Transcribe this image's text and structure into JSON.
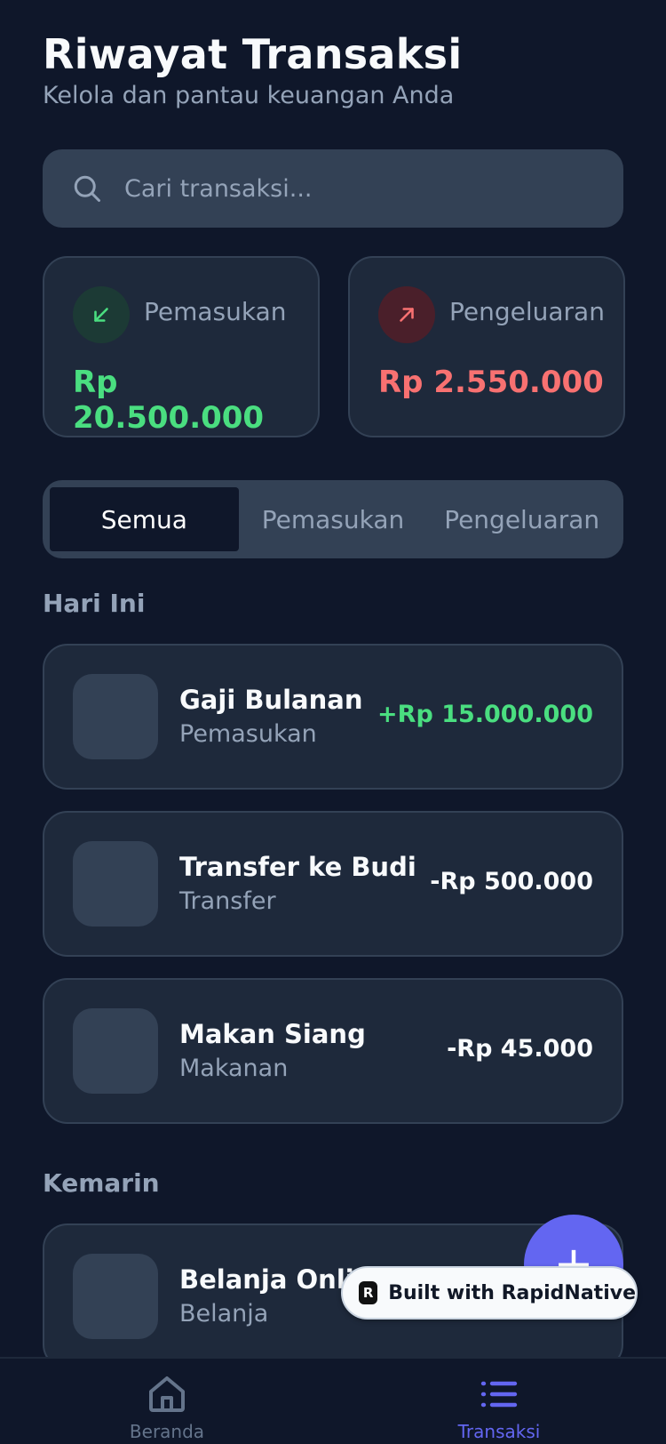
{
  "header": {
    "title": "Riwayat Transaksi",
    "subtitle": "Kelola dan pantau keuangan Anda"
  },
  "search": {
    "placeholder": "Cari transaksi...",
    "icon": "search-icon"
  },
  "summary": {
    "income": {
      "label": "Pemasukan",
      "value": "Rp 20.500.000",
      "icon": "arrow-down-left-icon",
      "color": "#4ade80"
    },
    "expense": {
      "label": "Pengeluaran",
      "value": "Rp 2.550.000",
      "icon": "arrow-up-right-icon",
      "color": "#f87171"
    }
  },
  "tabs": [
    {
      "label": "Semua",
      "active": true
    },
    {
      "label": "Pemasukan",
      "active": false
    },
    {
      "label": "Pengeluaran",
      "active": false
    }
  ],
  "sections": {
    "today": "Hari Ini",
    "yesterday": "Kemarin"
  },
  "transactions": [
    {
      "name": "Gaji Bulanan",
      "category": "Pemasukan",
      "amount": "+Rp 15.000.000"
    },
    {
      "name": "Transfer ke Budi",
      "category": "Transfer",
      "amount": "-Rp 500.000"
    },
    {
      "name": "Makan Siang",
      "category": "Makanan",
      "amount": "-Rp 45.000"
    },
    {
      "name": "Belanja Online",
      "category": "Belanja",
      "amount": ""
    }
  ],
  "fab": {
    "label": "+"
  },
  "badge": {
    "text": "Built with RapidNative"
  },
  "nav": [
    {
      "label": "Beranda",
      "icon": "home-icon",
      "active": false
    },
    {
      "label": "Transaksi",
      "icon": "list-icon",
      "active": true
    }
  ],
  "colors": {
    "background": "#0f172a",
    "card": "#1e293b",
    "accent": "#6366f1",
    "income": "#4ade80",
    "expense": "#f87171"
  }
}
